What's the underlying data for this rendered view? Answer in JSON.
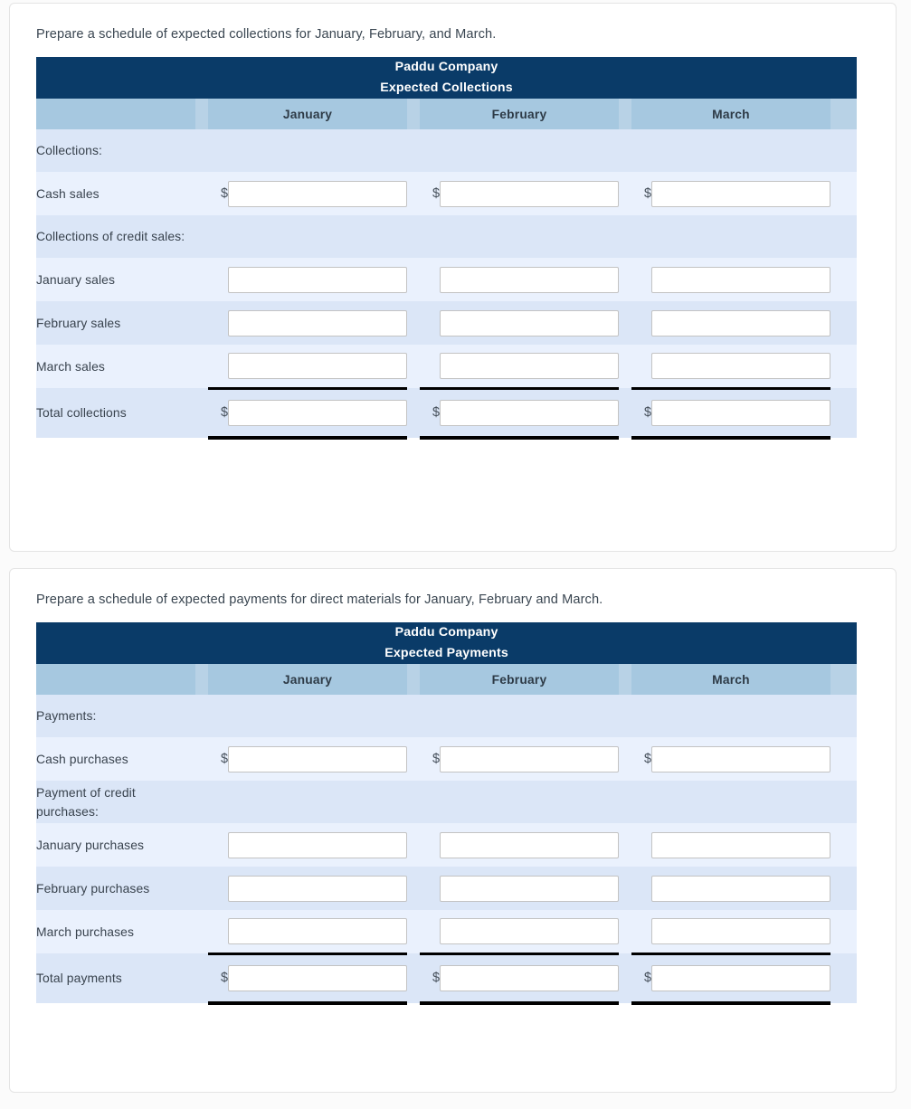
{
  "cards": [
    {
      "instruction": "Prepare a schedule of expected collections for January, February, and March.",
      "title_line1": "Paddu Company",
      "title_line2": "Expected Collections",
      "months": [
        "January",
        "February",
        "March"
      ],
      "rows": [
        {
          "label": "Collections:",
          "type": "section"
        },
        {
          "label": "Cash sales",
          "type": "input",
          "dollar": true
        },
        {
          "label": "Collections of credit sales:",
          "type": "section"
        },
        {
          "label": "January sales",
          "type": "input",
          "dollar": false
        },
        {
          "label": "February sales",
          "type": "input",
          "dollar": false
        },
        {
          "label": "March sales",
          "type": "input",
          "dollar": false
        },
        {
          "label": "Total collections",
          "type": "total",
          "dollar": true
        }
      ]
    },
    {
      "instruction": "Prepare a schedule of expected payments for direct materials for January, February and March.",
      "title_line1": "Paddu Company",
      "title_line2": "Expected Payments",
      "months": [
        "January",
        "February",
        "March"
      ],
      "rows": [
        {
          "label": "Payments:",
          "type": "section"
        },
        {
          "label": "Cash purchases",
          "type": "input",
          "dollar": true
        },
        {
          "label": "Payment of credit purchases:",
          "type": "section"
        },
        {
          "label": "January purchases",
          "type": "input",
          "dollar": false
        },
        {
          "label": "February purchases",
          "type": "input",
          "dollar": false
        },
        {
          "label": "March purchases",
          "type": "input",
          "dollar": false
        },
        {
          "label": "Total payments",
          "type": "total",
          "dollar": true
        }
      ]
    }
  ],
  "symbols": {
    "dollar": "$"
  },
  "field_placeholder": "",
  "colors": {
    "header_bg": "#0a3b68",
    "month_bg": "#a6c8e0",
    "row_dark": "#dbe6f7",
    "row_light": "#eaf1fd",
    "rule": "#000000"
  }
}
